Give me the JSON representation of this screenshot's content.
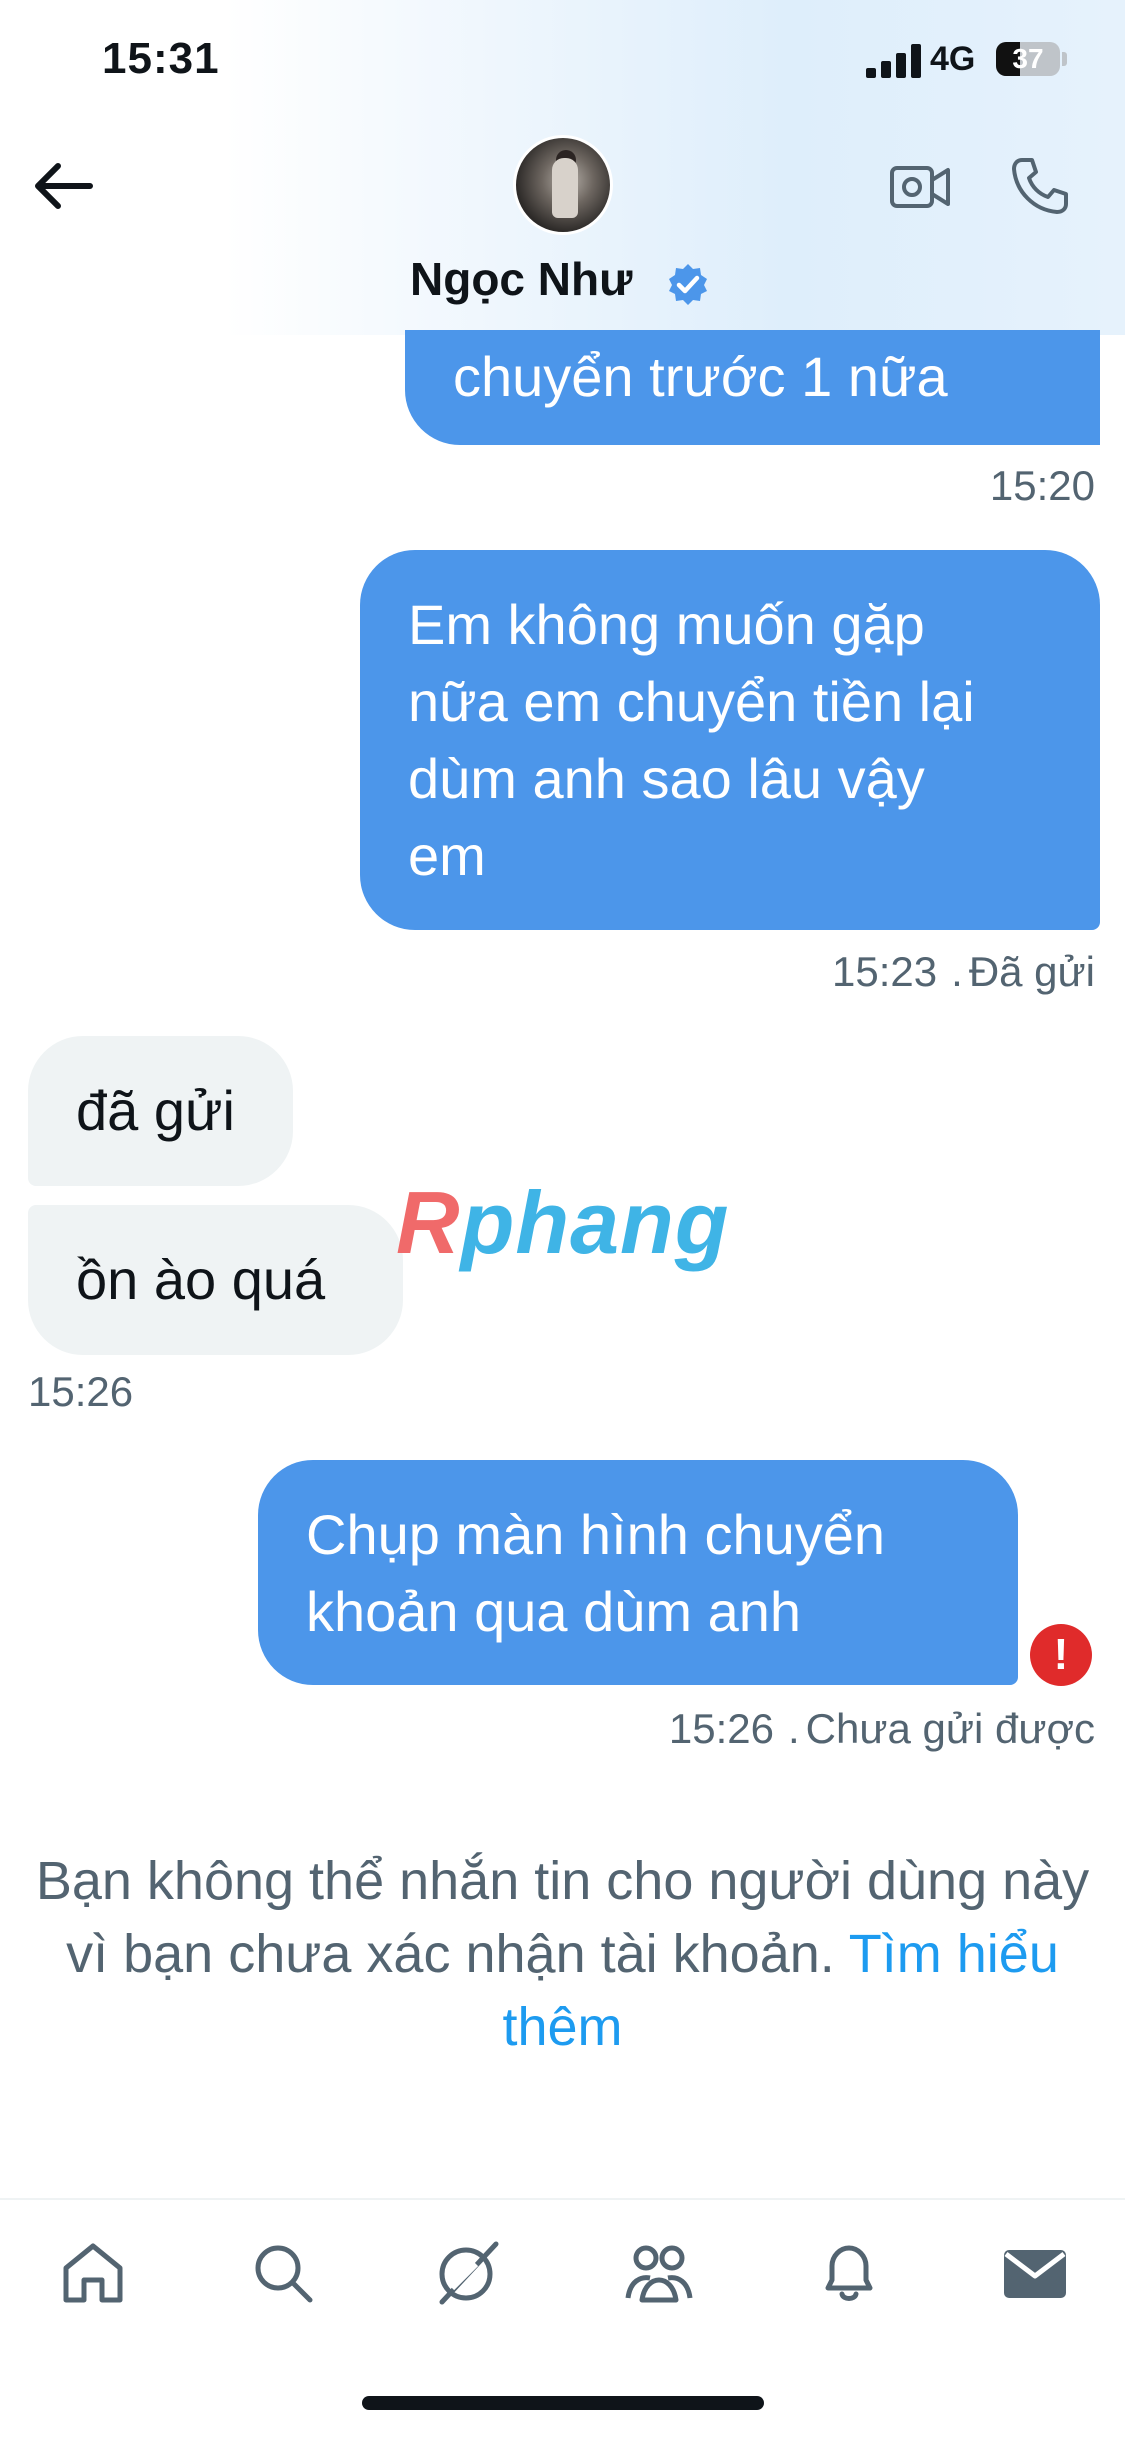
{
  "status_bar": {
    "time": "15:31",
    "network": "4G",
    "battery": "37",
    "battery_level_percent": 37
  },
  "header": {
    "contact_name": "Ngọc Như",
    "verified": true,
    "icons": [
      "back-arrow-icon",
      "video-call-icon",
      "phone-call-icon"
    ]
  },
  "messages": [
    {
      "direction": "outgoing",
      "lines": [
        "chuyển trước 1 nữa"
      ],
      "time": "15:20",
      "status": ""
    },
    {
      "direction": "outgoing",
      "lines": [
        "Em không muốn gặp",
        "nữa em chuyển tiền lại",
        "dùm anh sao lâu vậy",
        "em"
      ],
      "time": "15:23",
      "status": "Đã gửi"
    },
    {
      "direction": "incoming",
      "lines": [
        "đã gửi"
      ]
    },
    {
      "direction": "incoming",
      "lines": [
        "ồn ào quá"
      ],
      "time": "15:26"
    },
    {
      "direction": "outgoing",
      "lines": [
        "Chụp màn hình chuyển",
        "khoản qua dùm anh"
      ],
      "time": "15:26",
      "status": "Chưa gửi được",
      "error": "!"
    }
  ],
  "watermark": {
    "part1": "R",
    "part2": "phang"
  },
  "notice": {
    "text": "Bạn không thể nhắn tin cho người dùng này vì bạn chưa xác nhận tài khoản. ",
    "link": "Tìm hiểu thêm"
  },
  "bottom_nav": {
    "items": [
      "home-icon",
      "search-icon",
      "grok-icon",
      "communities-icon",
      "notifications-icon",
      "messages-icon"
    ]
  },
  "colors": {
    "outgoing_bubble": "#4c96ea",
    "incoming_bubble": "#eff3f4",
    "link": "#1d9bf0",
    "error": "#e02b2b",
    "muted_text": "#536471"
  }
}
